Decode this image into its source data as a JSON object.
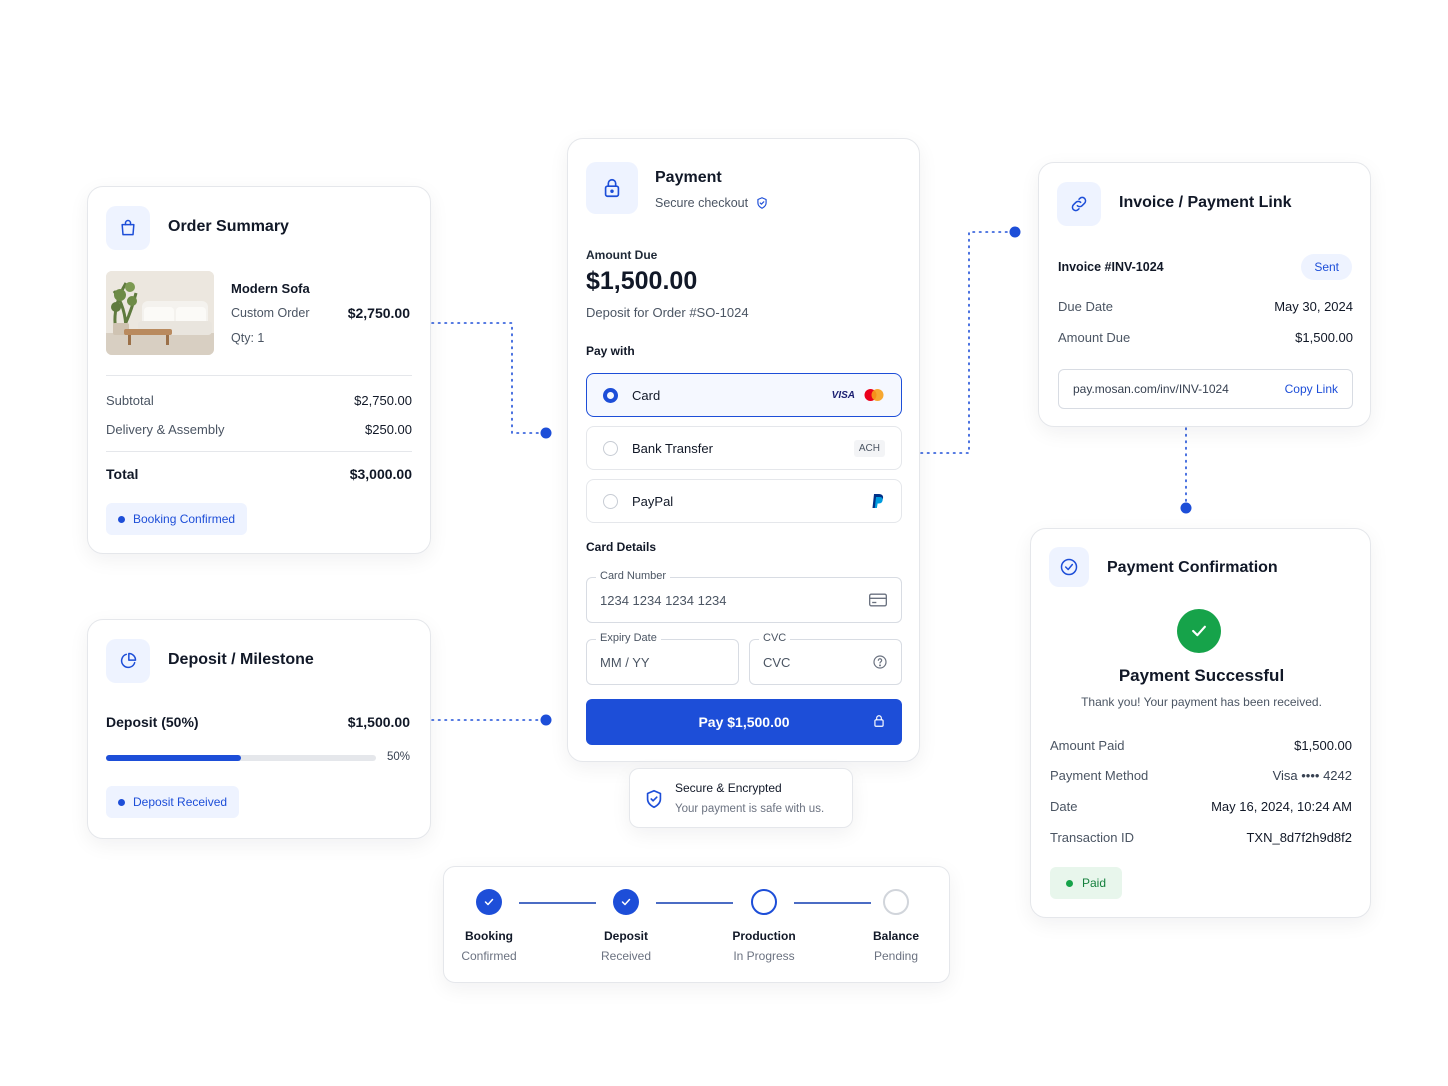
{
  "order_summary": {
    "title": "Order Summary",
    "product_name": "Modern Sofa",
    "product_type": "Custom Order",
    "qty": "Qty: 1",
    "product_price": "$2,750.00",
    "subtotal_label": "Subtotal",
    "subtotal_value": "$2,750.00",
    "delivery_label": "Delivery & Assembly",
    "delivery_value": "$250.00",
    "total_label": "Total",
    "total_value": "$3,000.00",
    "status": "Booking Confirmed"
  },
  "deposit": {
    "title": "Deposit / Milestone",
    "label": "Deposit (50%)",
    "value": "$1,500.00",
    "progress_label": "50%",
    "progress_fraction": 0.5,
    "status": "Deposit Received"
  },
  "payment": {
    "title": "Payment",
    "subtitle": "Secure checkout",
    "amount_label": "Amount Due",
    "amount": "$1,500.00",
    "deposit_note": "Deposit for Order #SO-1024",
    "pay_with_label": "Pay with",
    "options": [
      {
        "label": "Card",
        "badge": "VISA"
      },
      {
        "label": "Bank Transfer",
        "badge": "ACH"
      },
      {
        "label": "PayPal",
        "badge": ""
      }
    ],
    "card_details_label": "Card Details",
    "card_number_label": "Card Number",
    "card_number_placeholder": "1234 1234 1234 1234",
    "expiry_label": "Expiry Date",
    "expiry_placeholder": "MM / YY",
    "cvc_label": "CVC",
    "cvc_placeholder": "CVC",
    "pay_button": "Pay $1,500.00"
  },
  "secure": {
    "title": "Secure & Encrypted",
    "subtitle": "Your payment is safe with us."
  },
  "invoice": {
    "title": "Invoice / Payment Link",
    "number": "Invoice #INV-1024",
    "status": "Sent",
    "due_label": "Due Date",
    "due_value": "May 30, 2024",
    "amount_label": "Amount Due",
    "amount_value": "$1,500.00",
    "link": "pay.mosan.com/inv/INV-1024",
    "copy_label": "Copy Link"
  },
  "confirmation": {
    "title": "Payment Confirmation",
    "headline": "Payment Successful",
    "message": "Thank you! Your payment has been received.",
    "rows": [
      {
        "label": "Amount Paid",
        "value": "$1,500.00"
      },
      {
        "label": "Payment Method",
        "value": "Visa •••• 4242"
      },
      {
        "label": "Date",
        "value": "May 16, 2024, 10:24 AM"
      },
      {
        "label": "Transaction ID",
        "value": "TXN_8d7f2h9d8f2"
      }
    ],
    "status": "Paid"
  },
  "steps": [
    {
      "title": "Booking",
      "sub": "Confirmed"
    },
    {
      "title": "Deposit",
      "sub": "Received"
    },
    {
      "title": "Production",
      "sub": "In Progress"
    },
    {
      "title": "Balance",
      "sub": "Pending"
    }
  ],
  "colors": {
    "accent": "#1d4ed8",
    "success": "#16a34a",
    "success_bg": "#e8f6ec"
  }
}
